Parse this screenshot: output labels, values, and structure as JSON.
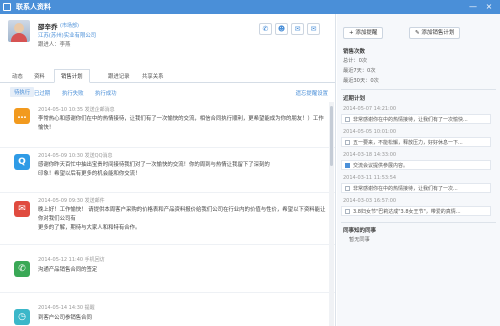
{
  "window": {
    "title": "联系人资料",
    "controls": [
      "—",
      "×"
    ]
  },
  "profile": {
    "name": "邵辛乔",
    "tag": "(市场部)",
    "company": "江苏(苏州)实业有限公司",
    "info": "跟进人：李燕",
    "actions": [
      "phone-icon",
      "person-icon",
      "message-icon",
      "mail-icon"
    ]
  },
  "tabs": [
    "动态",
    "资料",
    "销售计划",
    "跟进记录",
    "共享关系"
  ],
  "active_tab_index": 2,
  "subtabs": [
    "待执行",
    "已过期",
    "执行失败",
    "执行成功"
  ],
  "set_reminder_label": "遗忘提醒设置",
  "feed": [
    {
      "icon": "chat-icon",
      "color": "#f29a1e",
      "meta": "2014-05-10 10:35  发送企邮消息",
      "lines": [
        "李常热心和感谢你们在中的热情接待，让我们有了一次愉快的交流，相信合同执行顺利，更希望能成为你的朋友！）工作",
        "愉快！"
      ]
    },
    {
      "icon": "qq-icon",
      "color": "#2f9be6",
      "meta": "2014-05-09 10:30  发送QQ消息",
      "lines": [
        "感谢你昨天百忙中抽出宝贵时间接待我们对了一次愉快的交流！你的周到与热情让我留下了深刻的",
        "印象！希望以后有更多的机会能和你交流！"
      ]
    },
    {
      "icon": "mail-icon",
      "color": "#e04b3f",
      "meta": "2014-05-09 09:30  发送邮件",
      "lines": [
        "晚上好！工作愉快！    请提供本周客户采购的价格表和产品资料报价给我们公司在行业内的价值与性价，希望以下资料能让你对我们公司有",
        "更多的了解，期待与大家人和和特有合作。"
      ]
    },
    {
      "icon": "phone-icon",
      "color": "#3aa856",
      "meta": "2014-05-12 11:40  手机回访",
      "lines": [
        "沟通产品销售合同的签定"
      ]
    },
    {
      "icon": "clock-icon",
      "color": "#3bb7c9",
      "meta": "2014-05-14 14:30  提醒",
      "lines": [
        "到客户公司参销售合同"
      ]
    }
  ],
  "right": {
    "add_reminder": "添加提醒",
    "add_plan": "添加销售计划",
    "sales_title": "销售次数",
    "sales_summary": [
      "总计：0次",
      "最近7天：0次",
      "最近30天：0次"
    ],
    "plans_title": "近期计划",
    "plans": [
      {
        "date": "2014-05-07 14:21:00",
        "text": "非常感谢你在中的热情接待，让我们有了一次愉快...",
        "done": false
      },
      {
        "date": "2014-05-05 10:01:00",
        "text": "五一要来，不能松懈，释放压力，好好休息一下...",
        "done": false
      },
      {
        "date": "2014-03-18 14:33:00",
        "text": "交流会议提供参展内容。",
        "done": true
      },
      {
        "date": "2014-03-11 11:53:54",
        "text": "非常感谢你在中的热情接待，让我们有了一次...",
        "done": false
      },
      {
        "date": "2014-03-03 16:57:00",
        "text": "3.8妇女节\"巴莉达成\"3.8女王节\"，带爱的真情...",
        "done": false
      }
    ],
    "colleagues_title": "同事知的同事",
    "colleagues_empty": "暂无同事"
  }
}
